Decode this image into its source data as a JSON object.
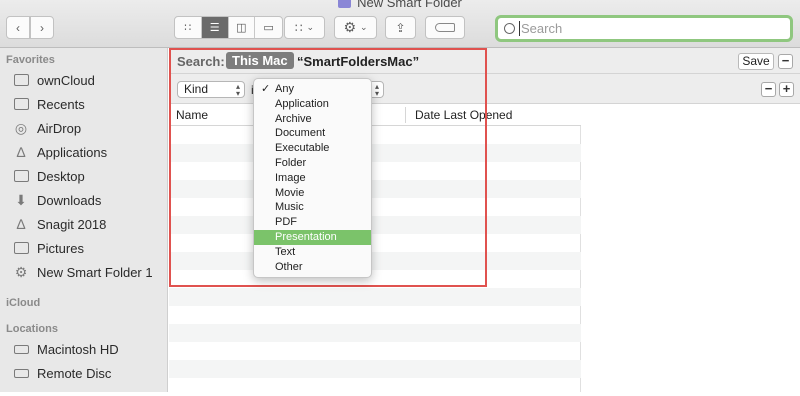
{
  "window": {
    "title": "New Smart Folder"
  },
  "toolbar": {
    "search_placeholder": "Search"
  },
  "sidebar": {
    "favorites_header": "Favorites",
    "favorites": [
      {
        "label": "ownCloud",
        "icon": "folder-icon"
      },
      {
        "label": "Recents",
        "icon": "clock-icon"
      },
      {
        "label": "AirDrop",
        "icon": "airdrop-icon"
      },
      {
        "label": "Applications",
        "icon": "applications-icon"
      },
      {
        "label": "Desktop",
        "icon": "desktop-icon"
      },
      {
        "label": "Downloads",
        "icon": "downloads-icon"
      },
      {
        "label": "Snagit 2018",
        "icon": "applications-icon"
      },
      {
        "label": "Pictures",
        "icon": "camera-icon"
      },
      {
        "label": "New Smart Folder 1",
        "icon": "gear-icon"
      }
    ],
    "icloud_header": "iCloud",
    "locations_header": "Locations",
    "locations": [
      {
        "label": "Macintosh HD",
        "icon": "disk-icon"
      },
      {
        "label": "Remote Disc",
        "icon": "disc-icon"
      }
    ]
  },
  "search_bar": {
    "label": "Search:",
    "scope_active": "This Mac",
    "scope_folder": "“SmartFoldersMac”",
    "save_label": "Save",
    "remove_label": "−",
    "add_label": "+"
  },
  "criteria": {
    "attribute": "Kind",
    "operator_prefix": "i"
  },
  "table": {
    "columns": [
      "Name",
      "Date Last Opened"
    ]
  },
  "kind_menu": {
    "checked_item": "Any",
    "selected_item": "Presentation",
    "items": [
      "Any",
      "Application",
      "Archive",
      "Document",
      "Executable",
      "Folder",
      "Image",
      "Movie",
      "Music",
      "PDF",
      "Presentation",
      "Text",
      "Other"
    ]
  },
  "colors": {
    "highlight_border": "#e0524f",
    "menu_selection": "#7bc36a",
    "search_focus": "#8fc77f"
  }
}
